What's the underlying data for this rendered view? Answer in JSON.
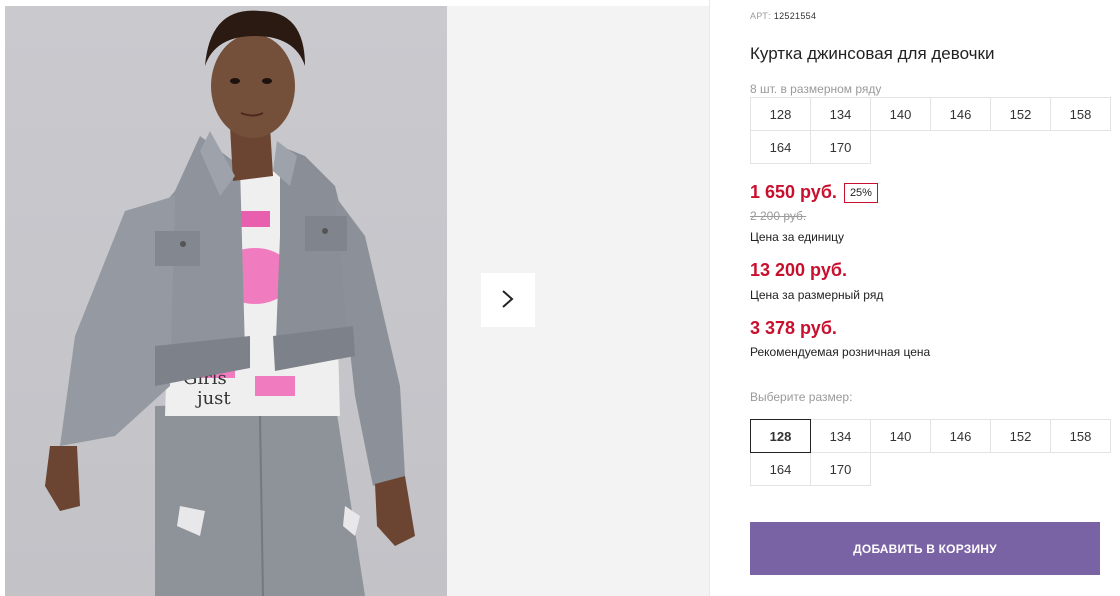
{
  "product": {
    "article_label": "АРТ:",
    "article_value": "12521554",
    "title": "Куртка джинсовая для девочки",
    "pack_note": "8 шт. в размерном ряду",
    "pack_sizes": [
      "128",
      "134",
      "140",
      "146",
      "152",
      "158",
      "164",
      "170"
    ]
  },
  "pricing": {
    "price": "1 650 руб.",
    "discount": "25%",
    "old_price": "2 200 руб.",
    "unit_label": "Цена за единицу",
    "row_price": "13 200 руб.",
    "row_label": "Цена за размерный ряд",
    "rrp_price": "3 378 руб.",
    "rrp_label": "Рекомендуемая розничная цена"
  },
  "size_select": {
    "label": "Выберите размер:",
    "options": [
      "128",
      "134",
      "140",
      "146",
      "152",
      "158",
      "164",
      "170"
    ],
    "selected": "128"
  },
  "cart": {
    "add_label": "ДОБАВИТЬ В КОРЗИНУ"
  },
  "gallery": {
    "next_icon": "chevron-right-icon"
  },
  "colors": {
    "price_red": "#c8102e",
    "button_purple": "#7a63a5"
  }
}
